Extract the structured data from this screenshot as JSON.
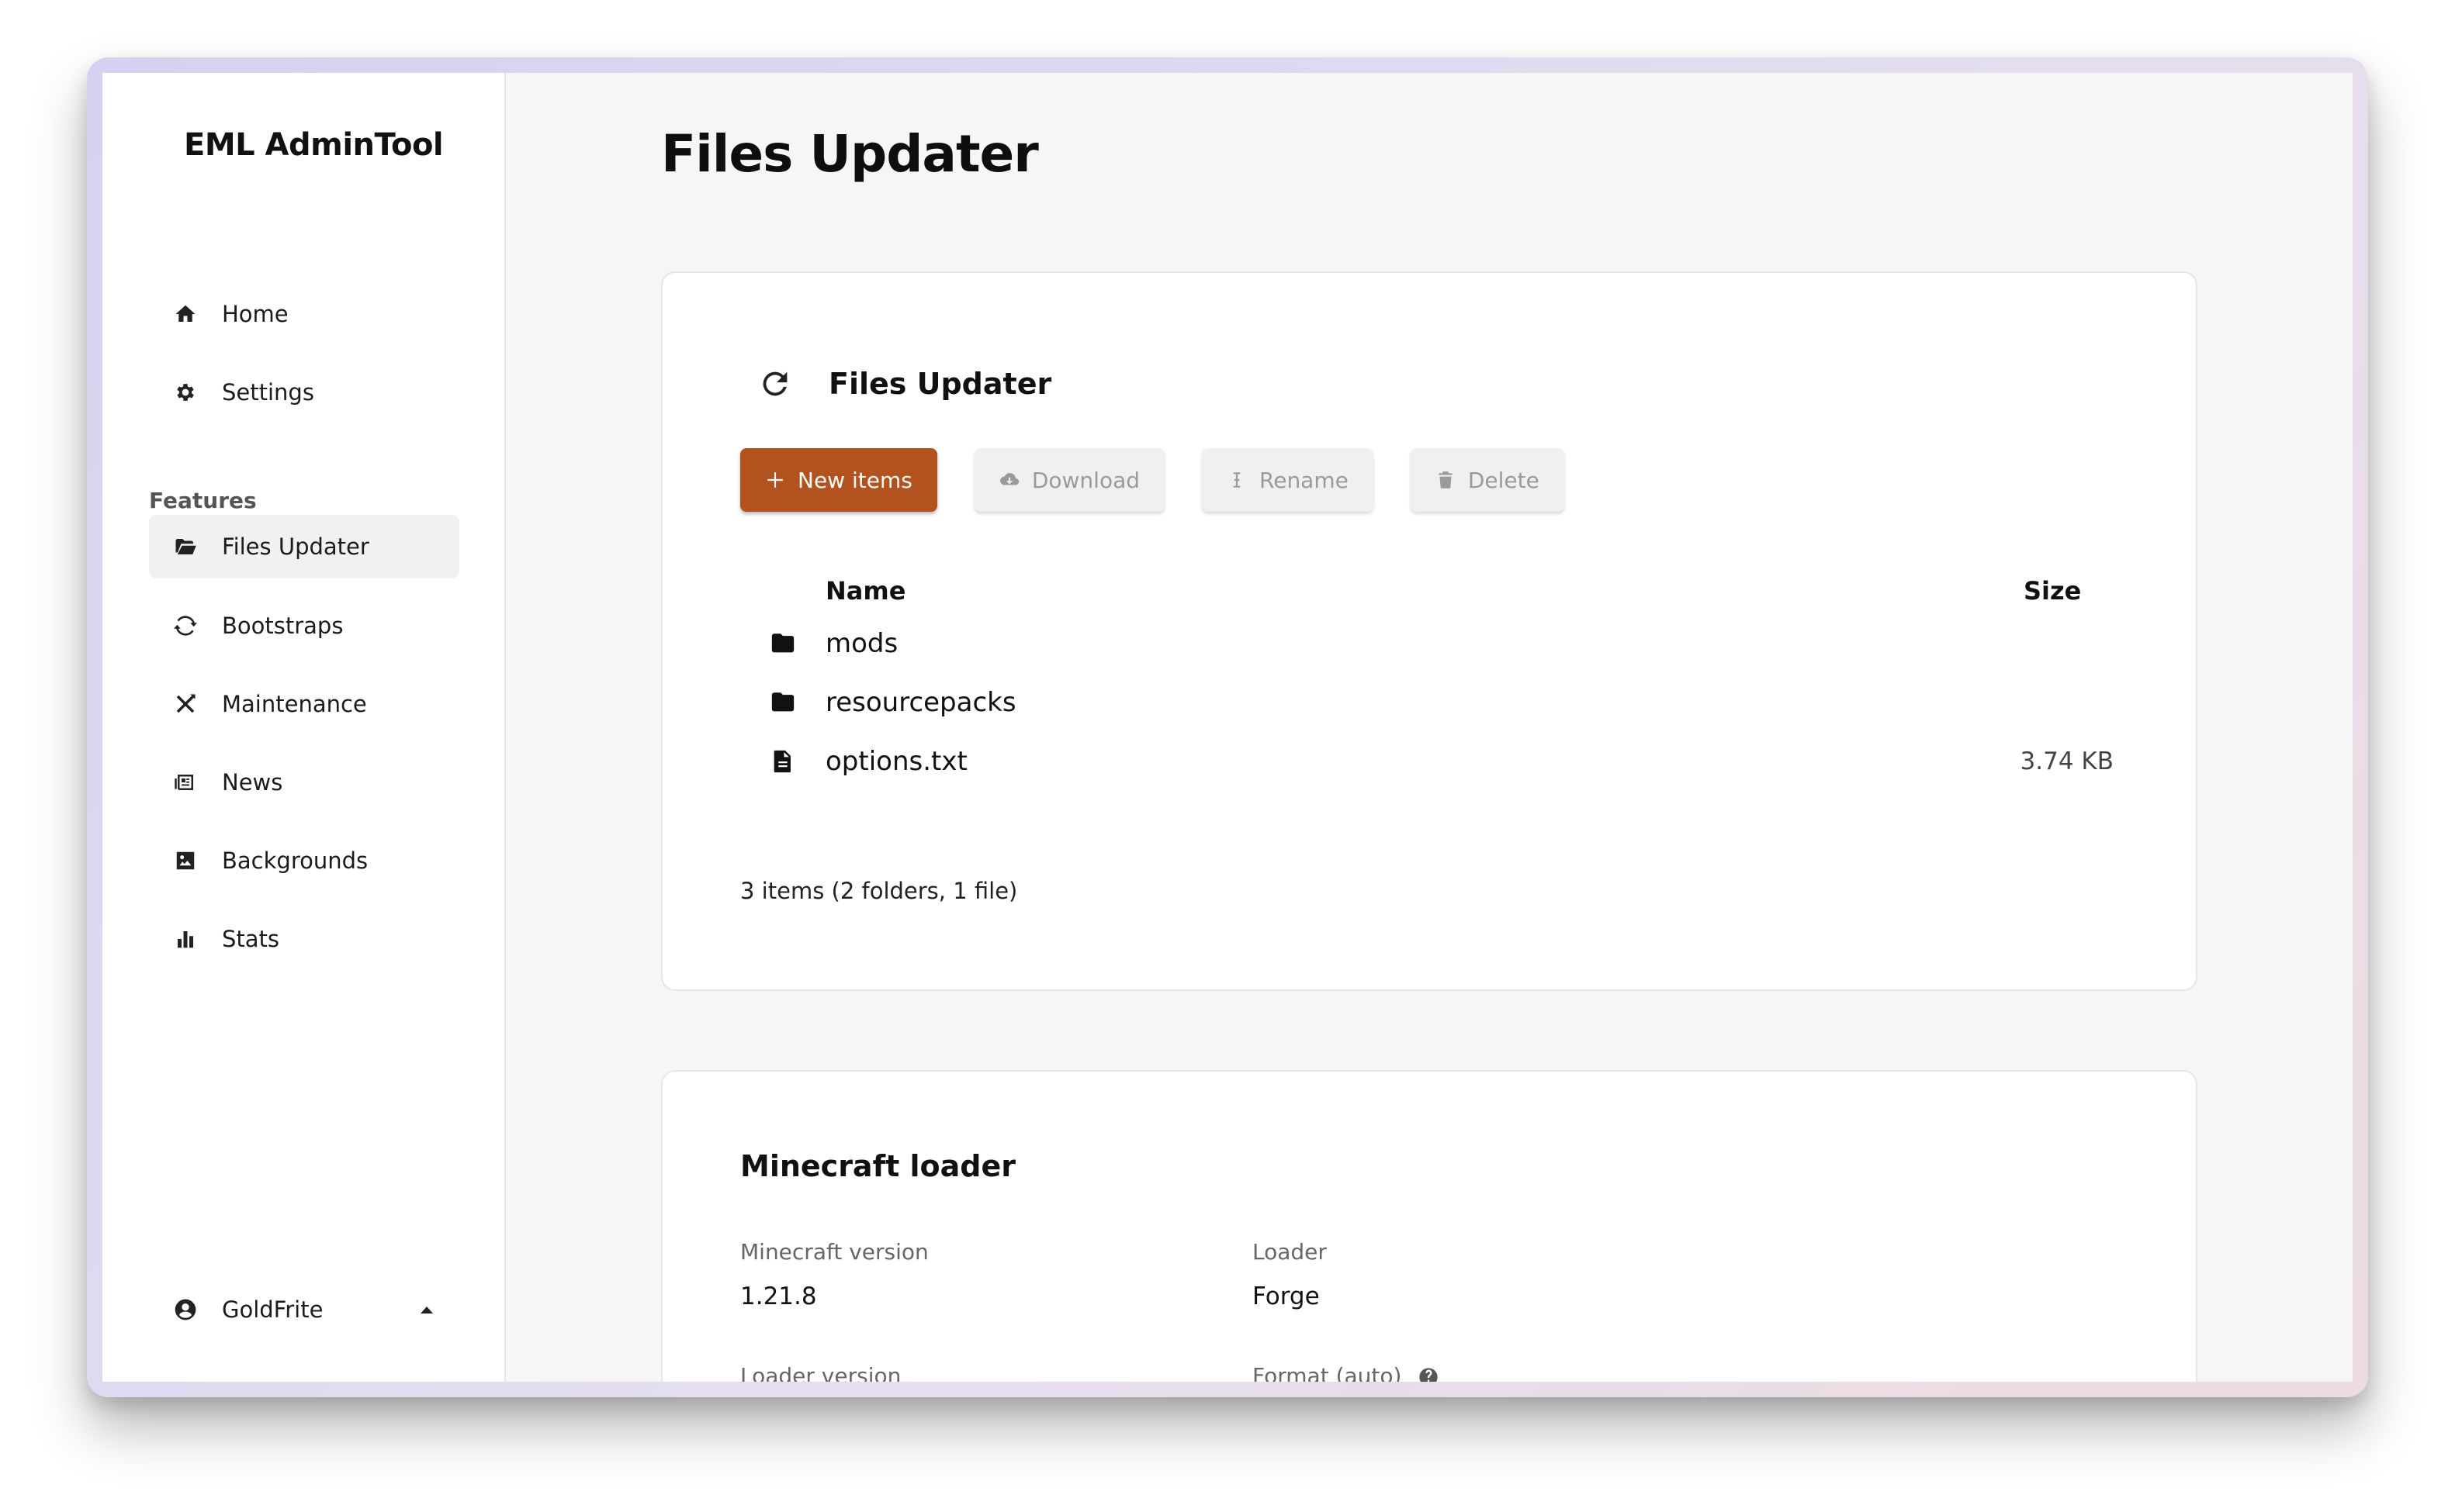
{
  "app": {
    "brand": "EML AdminTool"
  },
  "sidebar": {
    "top_items": [
      {
        "label": "Home",
        "icon": "home-icon"
      },
      {
        "label": "Settings",
        "icon": "gear-icon"
      }
    ],
    "section_label": "Features",
    "feature_items": [
      {
        "label": "Files Updater",
        "icon": "folder-open-icon",
        "active": true
      },
      {
        "label": "Bootstraps",
        "icon": "sync-icon"
      },
      {
        "label": "Maintenance",
        "icon": "tools-icon"
      },
      {
        "label": "News",
        "icon": "newspaper-icon"
      },
      {
        "label": "Backgrounds",
        "icon": "image-icon"
      },
      {
        "label": "Stats",
        "icon": "bar-chart-icon"
      }
    ],
    "user": {
      "name": "GoldFrite",
      "icon": "user-circle-icon",
      "caret": "caret-up-icon"
    }
  },
  "page": {
    "title": "Files Updater"
  },
  "files_card": {
    "title": "Files Updater",
    "refresh_icon": "refresh-icon",
    "buttons": {
      "new_items": "New items",
      "download": "Download",
      "rename": "Rename",
      "delete": "Delete"
    },
    "table": {
      "headers": {
        "name": "Name",
        "size": "Size"
      },
      "rows": [
        {
          "icon": "folder-icon",
          "name": "mods",
          "size": ""
        },
        {
          "icon": "folder-icon",
          "name": "resourcepacks",
          "size": ""
        },
        {
          "icon": "file-icon",
          "name": "options.txt",
          "size": "3.74 KB"
        }
      ]
    },
    "summary": "3 items (2 folders, 1 file)"
  },
  "loader_card": {
    "title": "Minecraft loader",
    "minecraft_version_label": "Minecraft version",
    "minecraft_version_value": "1.21.8",
    "loader_label": "Loader",
    "loader_value": "Forge",
    "loader_version_label": "Loader version",
    "format_label": "Format (auto)"
  },
  "colors": {
    "accent": "#b1521f",
    "page_bg": "#f6f6f6"
  }
}
